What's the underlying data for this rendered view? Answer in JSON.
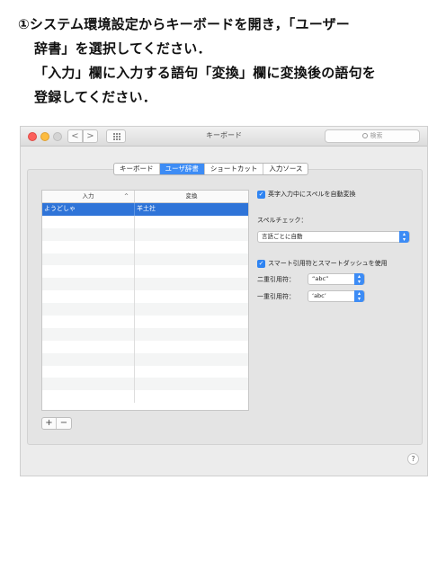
{
  "instructions": {
    "line1": "①システム環境設定からキーボードを開き，「ユーザー",
    "line2": "辞書」を選択してください．",
    "line3": "「入力」欄に入力する語句「変換」欄に変換後の語句を",
    "line4": "登録してください．"
  },
  "window": {
    "title": "キーボード",
    "search_placeholder": "検索",
    "back_glyph": "<",
    "forward_glyph": ">",
    "help_glyph": "?"
  },
  "tabs": [
    {
      "label": "キーボード",
      "active": false
    },
    {
      "label": "ユーザ辞書",
      "active": true
    },
    {
      "label": "ショートカット",
      "active": false
    },
    {
      "label": "入力ソース",
      "active": false
    }
  ],
  "dictionary": {
    "col_input": "入力",
    "col_convert": "変換",
    "sort_glyph": "^",
    "rows": [
      {
        "input": "ようどしゃ",
        "convert": "羊土社",
        "selected": true
      }
    ],
    "empty_rows": 15,
    "add_label": "+",
    "remove_label": "−"
  },
  "options": {
    "auto_convert_label": "英字入力中にスペルを自動変換",
    "auto_convert_checked": true,
    "spellcheck_label": "スペルチェック：",
    "spellcheck_value": "言語ごとに自動",
    "smart_quotes_label": "スマート引用符とスマートダッシュを使用",
    "smart_quotes_checked": true,
    "double_quote_label": "二重引用符：",
    "double_quote_value": "“abc”",
    "single_quote_label": "一重引用符：",
    "single_quote_value": "‘abc’"
  },
  "colors": {
    "accent": "#3d8cf5",
    "selection": "#2f74d8"
  }
}
